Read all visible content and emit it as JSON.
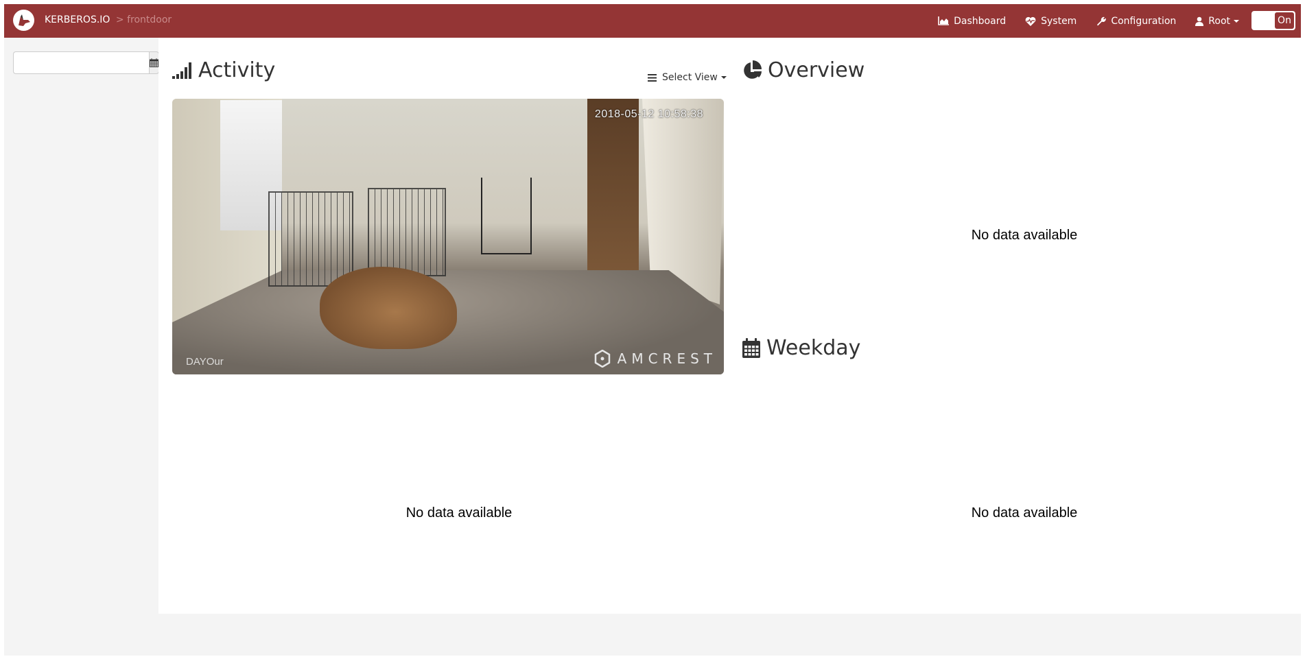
{
  "navbar": {
    "brand": "KERBEROS.IO",
    "breadcrumb": "> frontdoor",
    "items": [
      {
        "label": "Dashboard",
        "icon": "area-chart-icon"
      },
      {
        "label": "System",
        "icon": "heartbeat-icon"
      },
      {
        "label": "Configuration",
        "icon": "wrench-icon"
      },
      {
        "label": "Root",
        "icon": "user-icon"
      }
    ],
    "toggle_label": "On"
  },
  "sidebar": {
    "date_input": {
      "value": "",
      "placeholder": ""
    },
    "calendar_icon": "calendar-icon"
  },
  "panels": {
    "activity": {
      "title": "Activity",
      "select_view": "Select View",
      "no_data": "No data available"
    },
    "overview": {
      "title": "Overview",
      "no_data": "No data available"
    },
    "weekday": {
      "title": "Weekday",
      "no_data": "No data available"
    }
  },
  "camera": {
    "timestamp": "2018-05-12 10:58:38",
    "channel_label": "DAYOur",
    "brand_watermark": "AMCREST"
  },
  "colors": {
    "navbar": "#943535",
    "sidebar": "#f4f4f4",
    "text": "#333333"
  }
}
